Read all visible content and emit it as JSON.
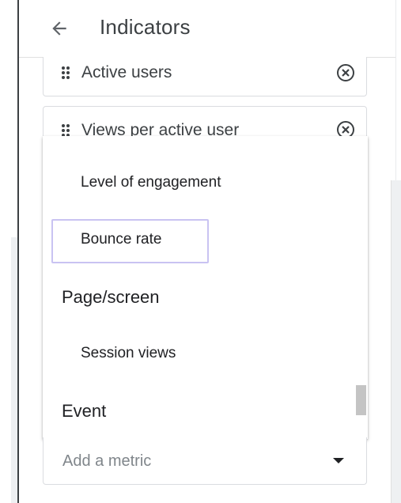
{
  "header": {
    "title": "Indicators"
  },
  "metrics": [
    {
      "label": "Active users"
    },
    {
      "label": "Views per active user"
    }
  ],
  "dropdown": {
    "options": [
      {
        "label": "Level of engagement",
        "type": "item"
      },
      {
        "label": "Bounce rate",
        "type": "item"
      },
      {
        "label": "Page/screen",
        "type": "group"
      },
      {
        "label": "Session views",
        "type": "item"
      },
      {
        "label": "Event",
        "type": "group"
      }
    ]
  },
  "add_metric": {
    "placeholder": "Add a metric"
  },
  "colors": {
    "focus": "#c9c3f2",
    "border": "#dadce0",
    "text": "#202124"
  }
}
